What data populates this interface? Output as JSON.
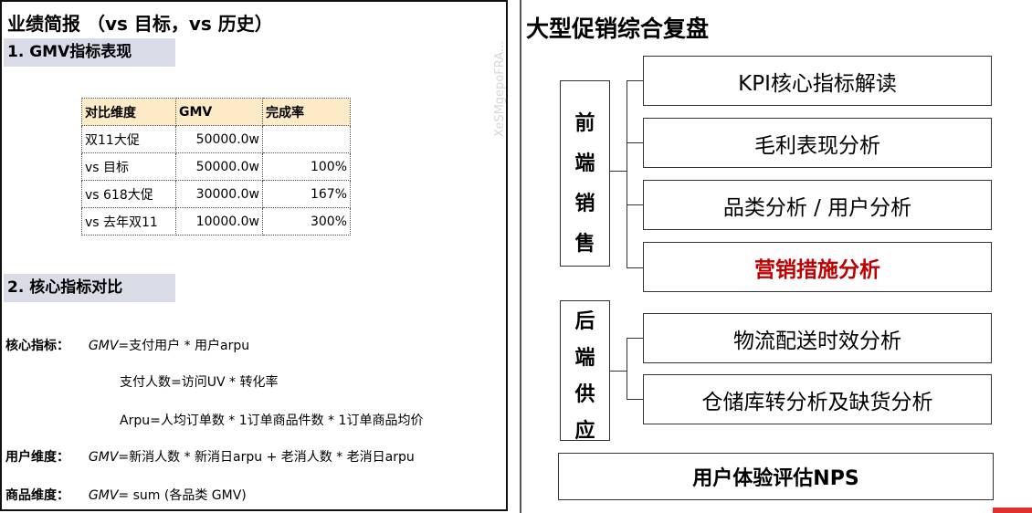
{
  "left": {
    "title": "业绩简报 （vs 目标，vs 历史）",
    "section1": "1. GMV指标表现",
    "table": {
      "headers": [
        "对比维度",
        "GMV",
        "完成率"
      ],
      "rows": [
        [
          "双11大促",
          "50000.0w",
          ""
        ],
        [
          "vs 目标",
          "50000.0w",
          "100%"
        ],
        [
          "vs 618大促",
          "30000.0w",
          "167%"
        ],
        [
          "vs 去年双11",
          "10000.0w",
          "300%"
        ]
      ]
    },
    "section2": "2. 核心指标对比",
    "core_label": "核心指标：",
    "core_var": "GMV",
    "core_formula": "=支付用户 * 用户arpu",
    "core_line2": "支付人数=访问UV * 转化率",
    "core_line3": "Arpu=人均订单数 * 1订单商品件数 * 1订单商品均价",
    "user_label": "用户维度：",
    "user_var": "GMV",
    "user_formula": "=新消人数 * 新消日arpu + 老消人数 * 老消日arpu",
    "product_label": "商品维度：",
    "product_var": "GMV",
    "product_formula": "= sum (各品类 GMV)"
  },
  "right": {
    "title": "大型促销综合复盘",
    "front_group": [
      "前",
      "端",
      "销",
      "售"
    ],
    "front_items": [
      "KPI核心指标解读",
      "毛利表现分析",
      "品类分析 / 用户分析",
      "营销措施分析"
    ],
    "back_group": [
      "后",
      "端",
      "供",
      "应"
    ],
    "back_items": [
      "物流配送时效分析",
      "仓储库转分析及缺货分析"
    ],
    "bottom": "用户体验评估NPS"
  },
  "watermark": "XeSMgepoFRA...",
  "colors": {
    "header_bg": "#d9dce6",
    "table_header_bg": "#fdebc8",
    "highlight_text": "#c00000"
  }
}
